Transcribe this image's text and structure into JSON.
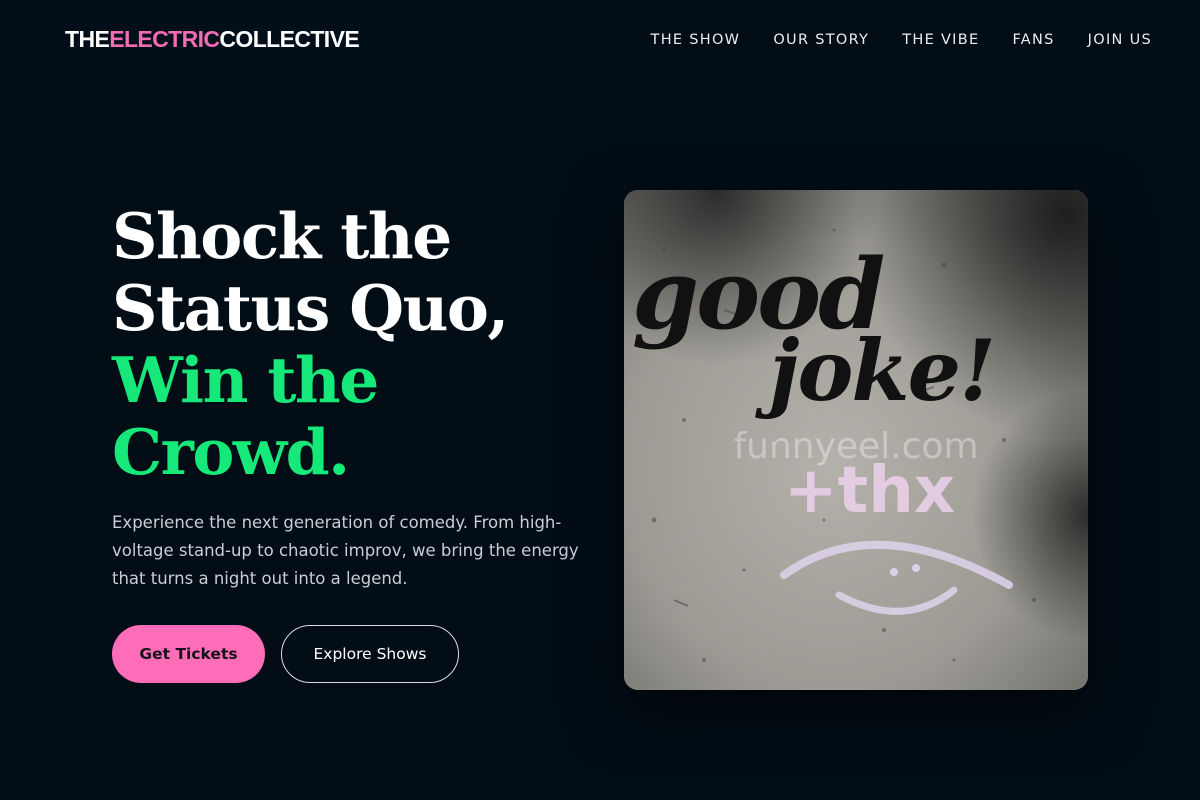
{
  "brand": {
    "prefix": "THE ",
    "accent": "ELECTRIC",
    "suffix": " COLLECTIVE"
  },
  "nav": {
    "items": [
      "THE SHOW",
      "OUR STORY",
      "THE VIBE",
      "FANS",
      "JOIN US"
    ]
  },
  "hero": {
    "headline_lines": [
      "Shock the",
      "Status Quo,"
    ],
    "headline_accent_lines": [
      "Win the",
      "Crowd."
    ],
    "description": "Experience the next generation of comedy. From high-voltage stand-up to chaotic improv, we bring the energy that turns a night out into a legend.",
    "primary_button": "Get Tickets",
    "secondary_button": "Explore Shows",
    "image": {
      "graffiti_line1": "good",
      "graffiti_line2": "joke!",
      "graffiti_tag": "+thx",
      "watermark": "funnyeel.com"
    }
  },
  "colors": {
    "background": "#020d16",
    "brand_accent": "#f26bb5",
    "headline_accent": "#16e87a",
    "primary_button": "#ff6cb8"
  }
}
